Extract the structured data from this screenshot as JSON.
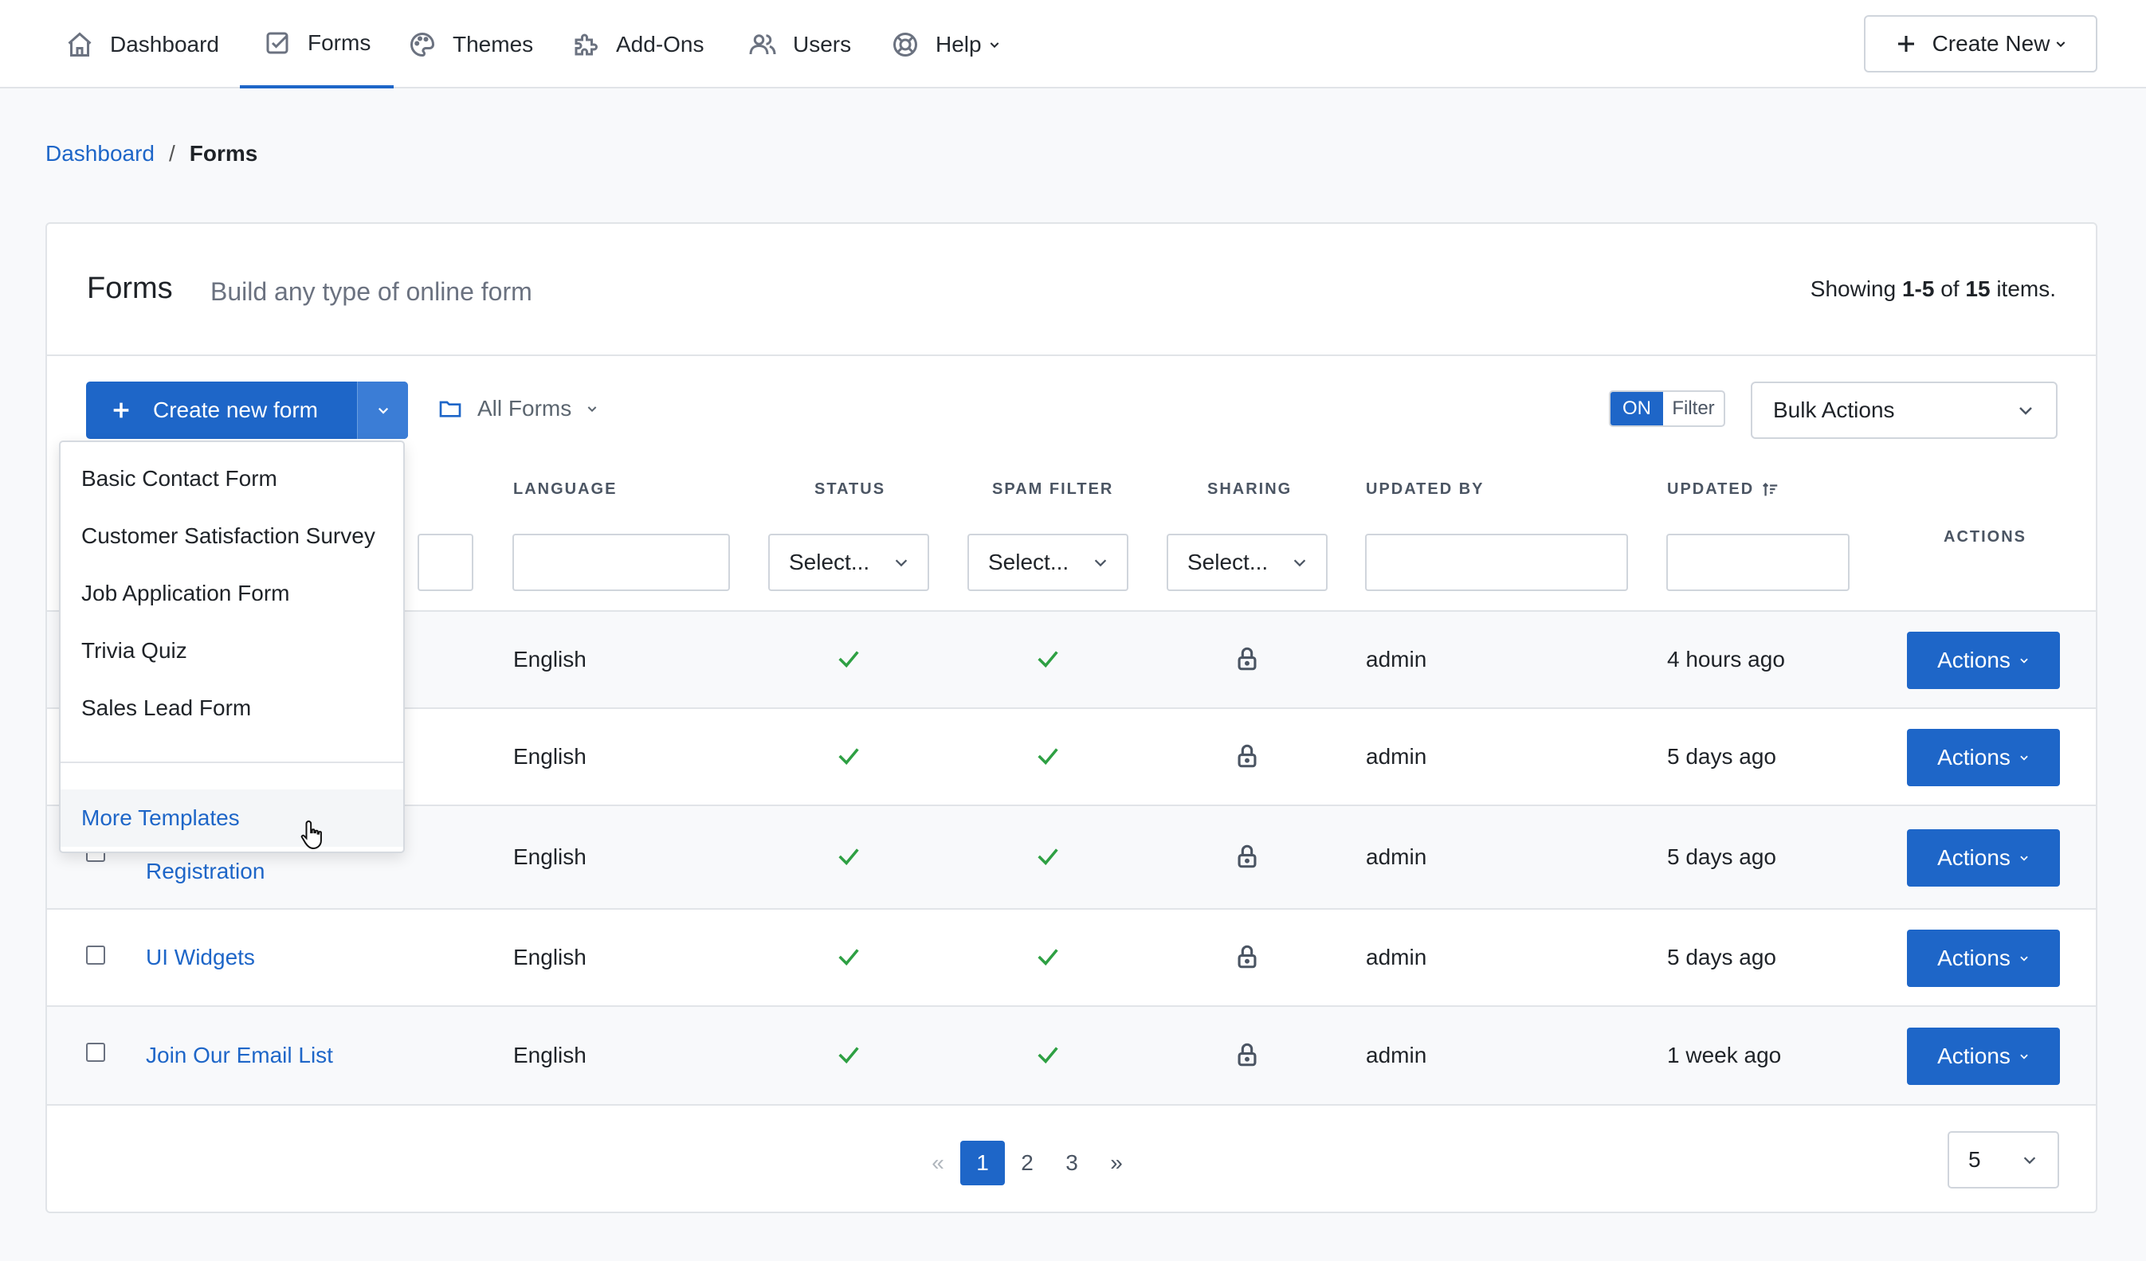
{
  "nav": {
    "items": [
      {
        "label": "Dashboard",
        "icon": "home-icon"
      },
      {
        "label": "Forms",
        "icon": "forms-icon"
      },
      {
        "label": "Themes",
        "icon": "palette-icon"
      },
      {
        "label": "Add-Ons",
        "icon": "puzzle-icon"
      },
      {
        "label": "Users",
        "icon": "users-icon"
      },
      {
        "label": "Help",
        "icon": "lifebuoy-icon"
      }
    ],
    "active": "Forms",
    "create_new_label": "Create New"
  },
  "breadcrumb": {
    "home": "Dashboard",
    "separator": "/",
    "current": "Forms"
  },
  "header": {
    "title": "Forms",
    "subtitle": "Build any type of online form",
    "showing_prefix": "Showing",
    "showing_range": "1-5",
    "showing_of": "of",
    "showing_total": "15",
    "showing_suffix": "items."
  },
  "toolbar": {
    "create_label": "Create new form",
    "folder_label": "All Forms",
    "toggle_on": "ON",
    "toggle_label": "Filter",
    "bulk_label": "Bulk Actions"
  },
  "table": {
    "columns": {
      "language": "LANGUAGE",
      "status": "STATUS",
      "spam": "SPAM FILTER",
      "sharing": "SHARING",
      "updated_by": "UPDATED BY",
      "updated": "UPDATED",
      "actions": "ACTIONS"
    },
    "select_placeholder": "Select...",
    "rows": [
      {
        "name": "",
        "language": "English",
        "updated_by": "admin",
        "updated": "4 hours ago",
        "action": "Actions"
      },
      {
        "name": "",
        "language": "English",
        "updated_by": "admin",
        "updated": "5 days ago",
        "action": "Actions"
      },
      {
        "name": "Registration",
        "language": "English",
        "updated_by": "admin",
        "updated": "5 days ago",
        "action": "Actions"
      },
      {
        "name": "UI Widgets",
        "language": "English",
        "updated_by": "admin",
        "updated": "5 days ago",
        "action": "Actions"
      },
      {
        "name": "Join Our Email List",
        "language": "English",
        "updated_by": "admin",
        "updated": "1 week ago",
        "action": "Actions"
      }
    ]
  },
  "pagination": {
    "prev": "«",
    "pages": [
      "1",
      "2",
      "3"
    ],
    "current": "1",
    "next": "»",
    "per_page": "5"
  },
  "dropdown": {
    "items": [
      "Basic Contact Form",
      "Customer Satisfaction Survey",
      "Job Application Form",
      "Trivia Quiz",
      "Sales Lead Form"
    ],
    "more": "More Templates"
  },
  "colors": {
    "accent": "#1e66c8",
    "success": "#2ea043",
    "border": "#e1e4e8"
  }
}
